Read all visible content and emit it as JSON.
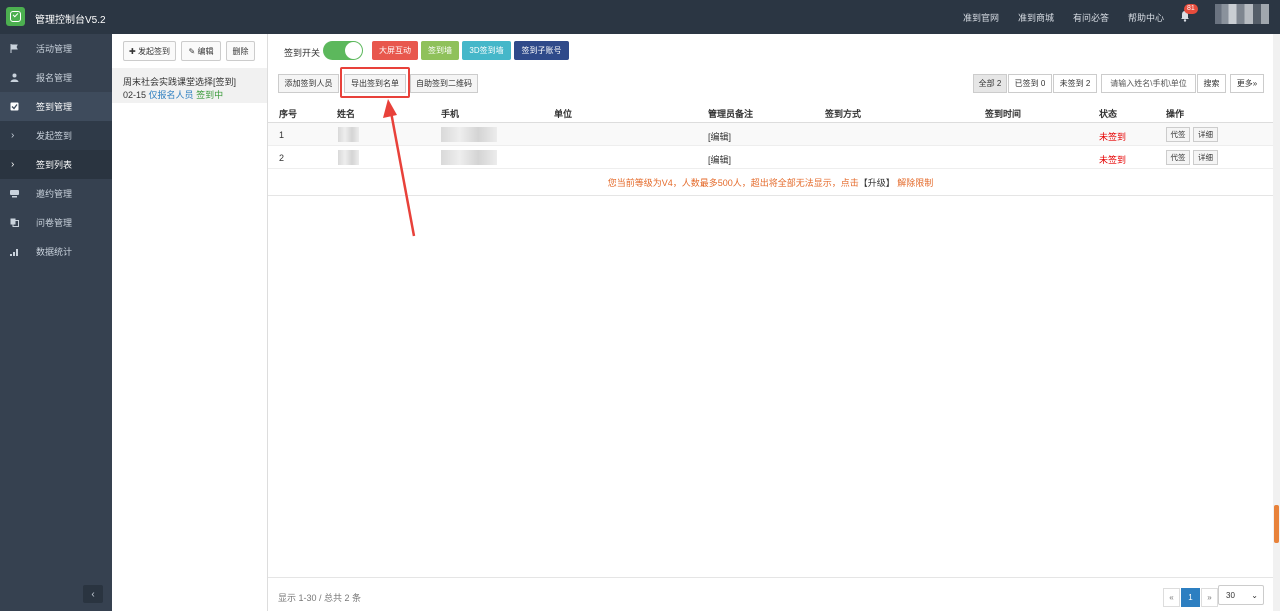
{
  "topbar": {
    "app_title": "管理控制台V5.2",
    "nav": [
      "准到官网",
      "准到商城",
      "有问必答",
      "帮助中心"
    ],
    "notification_count": "81"
  },
  "sidebar": {
    "items": [
      {
        "label": "活动管理",
        "icon": "flag-icon"
      },
      {
        "label": "报名管理",
        "icon": "user-icon"
      },
      {
        "label": "签到管理",
        "icon": "checkbox-icon"
      },
      {
        "label": "发起签到",
        "icon": "chevron-right-icon"
      },
      {
        "label": "签到列表",
        "icon": "chevron-right-icon"
      },
      {
        "label": "邀约管理",
        "icon": "invite-icon"
      },
      {
        "label": "问卷管理",
        "icon": "copy-icon"
      },
      {
        "label": "数据统计",
        "icon": "bar-chart-icon"
      }
    ],
    "collapse_label": "‹"
  },
  "col2": {
    "new_label": "✚ 发起签到",
    "edit_label": "✎ 编辑",
    "delete_label": "删除",
    "event": {
      "title": "周末社会实践课堂选择[签到]",
      "date": "02-15",
      "scope": "仅报名人员",
      "status": "签到中"
    }
  },
  "main": {
    "toggle_label": "签到开关",
    "channel_buttons": [
      {
        "label": "大屏互动",
        "color": "#e8574d"
      },
      {
        "label": "签到墙",
        "color": "#8fc15b"
      },
      {
        "label": "3D签到墙",
        "color": "#45b7c9"
      },
      {
        "label": "签到子账号",
        "color": "#2f4a8a"
      }
    ],
    "toolbar": {
      "add_label": "添加签到人员",
      "export_label": "导出签到名单",
      "qrcode_label": "自助签到二维码"
    },
    "filters": {
      "all": "全部 2",
      "signed": "已签到 0",
      "unsigned": "未签到 2",
      "search_placeholder": "请输入姓名\\手机\\单位",
      "search_label": "搜索",
      "more_label": "更多»"
    },
    "table": {
      "columns": [
        "序号",
        "姓名",
        "手机",
        "单位",
        "管理员备注",
        "签到方式",
        "签到时间",
        "状态",
        "操作"
      ],
      "rows": [
        {
          "no": "1",
          "remark": "[编辑]",
          "status": "未签到",
          "proxy": "代签",
          "detail": "详细"
        },
        {
          "no": "2",
          "remark": "[编辑]",
          "status": "未签到",
          "proxy": "代签",
          "detail": "详细"
        }
      ]
    },
    "notice": {
      "text": "您当前等级为V4，人数最多500人，超出将全部无法显示，点击",
      "upgrade": "【升级】",
      "unlock": "解除限制"
    },
    "footer": {
      "info": "显示 1-30 / 总共 2 条",
      "prev": "«",
      "current": "1",
      "next": "»",
      "page_size": "30"
    }
  }
}
